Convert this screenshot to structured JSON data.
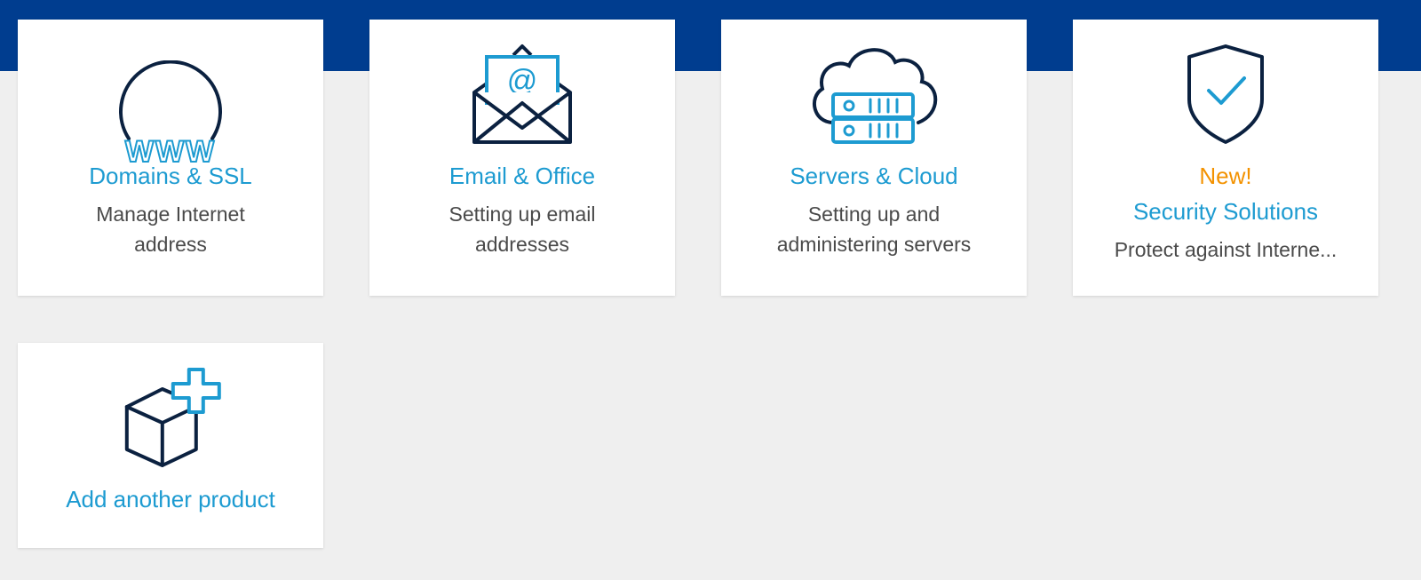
{
  "colors": {
    "header_band": "#003d8f",
    "background": "#efefef",
    "card": "#ffffff",
    "link_blue": "#1d9bd1",
    "icon_dark": "#0b2140",
    "new_orange": "#f39200",
    "text_gray": "#4a4a4a"
  },
  "cards": [
    {
      "icon": "globe-www-icon",
      "title": "Domains & SSL",
      "description": "Manage Internet address"
    },
    {
      "icon": "envelope-at-icon",
      "title": "Email & Office",
      "description": "Setting up email addresses"
    },
    {
      "icon": "cloud-server-icon",
      "title": "Servers & Cloud",
      "description": "Setting up and administering servers"
    },
    {
      "icon": "shield-check-icon",
      "badge": "New!",
      "title": "Security Solutions",
      "description": "Protect against Interne..."
    },
    {
      "icon": "box-plus-icon",
      "title": "Add another product"
    }
  ]
}
